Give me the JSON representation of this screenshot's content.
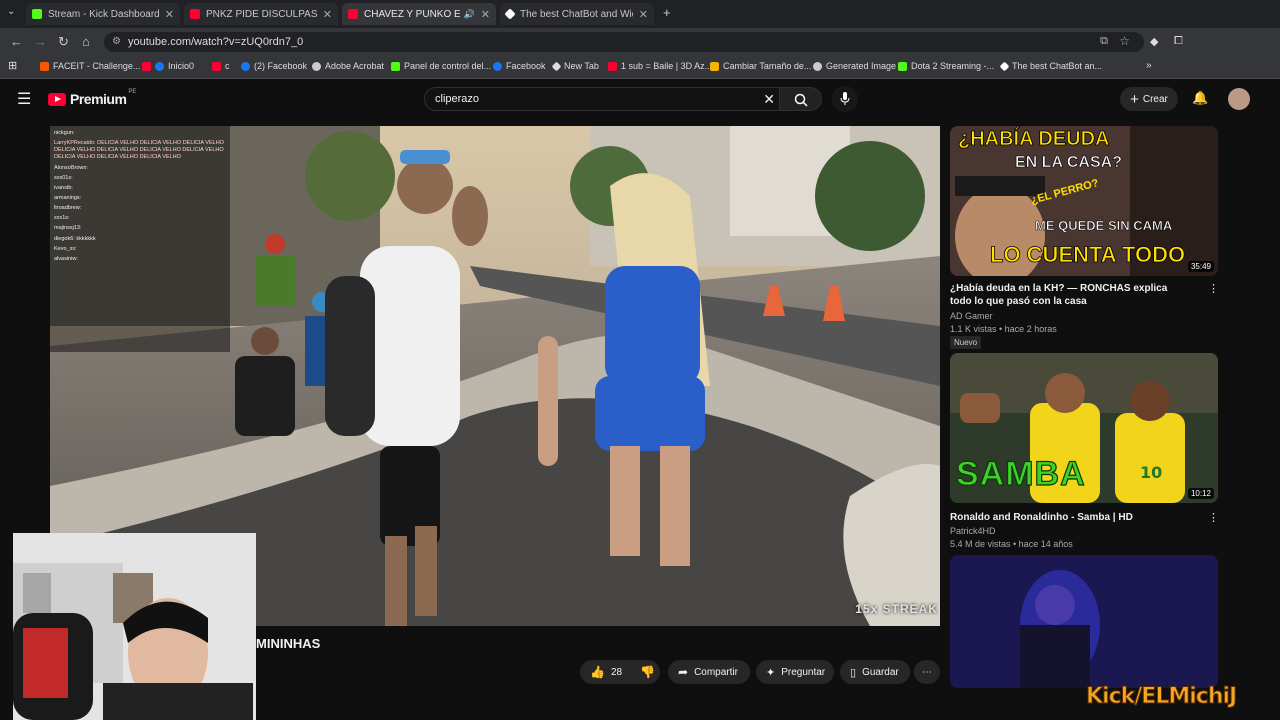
{
  "tabs": [
    {
      "title": "Stream - Kick Dashboard",
      "color": "#53fc18"
    },
    {
      "title": "PNKZ PIDE DISCULPAS A SU FA",
      "color": "#ff0033"
    },
    {
      "title": "CHAVEZ Y PUNKO ENCUEN",
      "color": "#ff0033"
    },
    {
      "title": "The best ChatBot and Widgets",
      "color": "#ffffff"
    }
  ],
  "address": {
    "url": "youtube.com/watch?v=zUQ0rdn7_0"
  },
  "bookmarks": [
    "FACEIT - Challenge...",
    "Inicio0",
    "c",
    "(2) Facebook",
    "Adobe Acrobat",
    "Panel de control del...",
    "Facebook",
    "New Tab",
    "1 sub = Baile | 3D Az...",
    "Cambiar Tamaño de...",
    "Generated Image",
    "Dota 2 Streaming -...",
    "The best ChatBot an..."
  ],
  "youtube": {
    "logo": "Premium",
    "logo_sup": "PE",
    "search_value": "cliperazo",
    "create_label": "Crear"
  },
  "chat": [
    "nickgun:",
    "LarryKPRecaido: DELICIA VELHO DELICIA VELHO DELICIA VELHO DELICIA VELHO DELICIA VELHO DELICIA VELHO DELICIA VELHO DELICIA VELHO DELICIA VELHO DELICIA VELHO",
    "AlonsoBrown:",
    "sxs01s:",
    "ivanstb:",
    "armanings:",
    "ltroadbrew:",
    "xxx1s:",
    "majinssj13:",
    "diegok6: kkkkkkk",
    "Kevo_xx:",
    "alvasiniw:"
  ],
  "video": {
    "title_partial": "MININHAS",
    "streak": "15x STREAK"
  },
  "actions": {
    "likes": "28",
    "share": "Compartir",
    "ask": "Preguntar",
    "save": "Guardar"
  },
  "suggestions": [
    {
      "thumb_line1": "¿HABÍA DEUDA",
      "thumb_line2": "EN LA CASA?",
      "thumb_line3": "¿EL PERRO?",
      "thumb_line4": "ME QUEDÉ SIN CAMA",
      "thumb_line5": "LO CUENTA TODO",
      "duration": "35:49",
      "title": "¿Había deuda en la KH? — RONCHAS explica todo lo que pasó con la casa",
      "channel": "AD Gamer",
      "meta": "1.1 K vistas • hace 2 horas",
      "badge": "Nuevo"
    },
    {
      "thumb_line1": "SAMBA",
      "duration": "10:12",
      "title": "Ronaldo and Ronaldinho - Samba | HD",
      "channel": "Patrick4HD",
      "meta": "5.4 M de vistas • hace 14 años"
    },
    {
      "duration": ""
    }
  ],
  "watermark": "Kick/ELMichiJ",
  "colors": {
    "yt_red": "#ff0033",
    "kick_green": "#53fc18",
    "bg": "#0f0f0f"
  }
}
